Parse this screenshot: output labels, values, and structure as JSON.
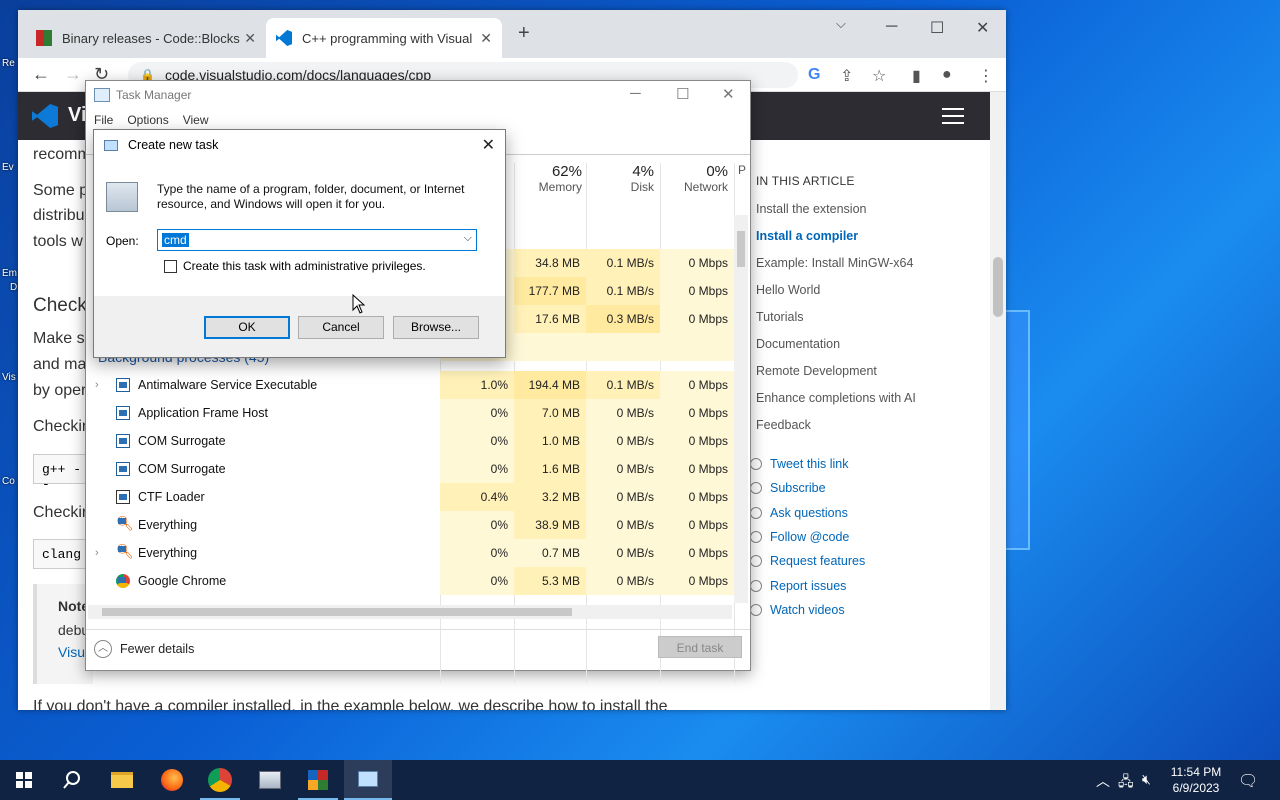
{
  "desktop": {
    "left_labels": [
      "Re",
      "Ev",
      "Em",
      "D",
      "Vis",
      "Co"
    ]
  },
  "chrome": {
    "tabs": [
      {
        "title": "Binary releases - Code::Blocks",
        "active": false
      },
      {
        "title": "C++ programming with Visual St",
        "active": true
      }
    ],
    "new_tab_label": "+",
    "url": "code.visualstudio.com/docs/languages/cpp"
  },
  "page": {
    "brand": "Vi",
    "left_text": {
      "recomm": "recomm",
      "some": "Some p",
      "distrib": "distribu",
      "tools": "tools w",
      "check": "Check",
      "make": "Make su",
      "and_ma": "and ma",
      "by_oper": "by oper",
      "checking1": "Checkir",
      "code1": "g++ --",
      "checking2": "Checkir",
      "code2": "clang",
      "note": "Note",
      "debu": "debu",
      "visu": "Visu",
      "bottom": "If you don't have a compiler installed, in the example below, we describe how to install the"
    },
    "toc": {
      "heading": "IN THIS ARTICLE",
      "items": [
        {
          "label": "Install the extension",
          "active": false
        },
        {
          "label": "Install a compiler",
          "active": true
        },
        {
          "label": "Example: Install MinGW-x64",
          "active": false
        },
        {
          "label": "Hello World",
          "active": false
        },
        {
          "label": "Tutorials",
          "active": false
        },
        {
          "label": "Documentation",
          "active": false
        },
        {
          "label": "Remote Development",
          "active": false
        },
        {
          "label": "Enhance completions with AI",
          "active": false
        },
        {
          "label": "Feedback",
          "active": false
        }
      ],
      "social": [
        "Tweet this link",
        "Subscribe",
        "Ask questions",
        "Follow @code",
        "Request features",
        "Report issues",
        "Watch videos"
      ]
    }
  },
  "task_manager": {
    "title": "Task Manager",
    "menu": [
      "File",
      "Options",
      "View"
    ],
    "columns": [
      {
        "pct": "62%",
        "name": "Memory"
      },
      {
        "pct": "4%",
        "name": "Disk"
      },
      {
        "pct": "0%",
        "name": "Network"
      },
      {
        "pct": "",
        "name": "P"
      }
    ],
    "apps_rows": [
      {
        "memory": "34.8 MB",
        "disk": "0.1 MB/s",
        "network": "0 Mbps"
      },
      {
        "memory": "177.7 MB",
        "disk": "0.1 MB/s",
        "network": "0 Mbps"
      },
      {
        "memory": "17.6 MB",
        "disk": "0.3 MB/s",
        "network": "0 Mbps"
      }
    ],
    "background_label": "Background processes (45)",
    "rows": [
      {
        "name": "Antimalware Service Executable",
        "cpu": "1.0%",
        "memory": "194.4 MB",
        "disk": "0.1 MB/s",
        "network": "0 Mbps",
        "expand": true
      },
      {
        "name": "Application Frame Host",
        "cpu": "0%",
        "memory": "7.0 MB",
        "disk": "0 MB/s",
        "network": "0 Mbps",
        "expand": false
      },
      {
        "name": "COM Surrogate",
        "cpu": "0%",
        "memory": "1.0 MB",
        "disk": "0 MB/s",
        "network": "0 Mbps",
        "expand": false
      },
      {
        "name": "COM Surrogate",
        "cpu": "0%",
        "memory": "1.6 MB",
        "disk": "0 MB/s",
        "network": "0 Mbps",
        "expand": false
      },
      {
        "name": "CTF Loader",
        "cpu": "0.4%",
        "memory": "3.2 MB",
        "disk": "0 MB/s",
        "network": "0 Mbps",
        "expand": false
      },
      {
        "name": "Everything",
        "cpu": "0%",
        "memory": "38.9 MB",
        "disk": "0 MB/s",
        "network": "0 Mbps",
        "expand": false
      },
      {
        "name": "Everything",
        "cpu": "0%",
        "memory": "0.7 MB",
        "disk": "0 MB/s",
        "network": "0 Mbps",
        "expand": true
      },
      {
        "name": "Google Chrome",
        "cpu": "0%",
        "memory": "5.3 MB",
        "disk": "0 MB/s",
        "network": "0 Mbps",
        "expand": false
      }
    ],
    "fewer_details": "Fewer details",
    "end_task": "End task"
  },
  "run_dialog": {
    "title": "Create new task",
    "description": "Type the name of a program, folder, document, or Internet resource, and Windows will open it for you.",
    "open_label": "Open:",
    "open_value": "cmd",
    "admin_checkbox_label": "Create this task with administrative privileges.",
    "ok_label": "OK",
    "cancel_label": "Cancel",
    "browse_label": "Browse..."
  },
  "taskbar": {
    "time": "11:54 PM",
    "date": "6/9/2023"
  }
}
